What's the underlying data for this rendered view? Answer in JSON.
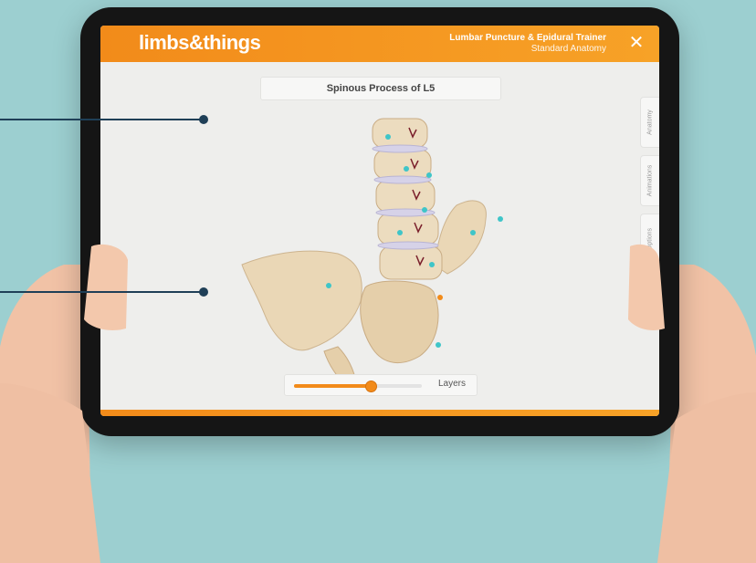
{
  "app": {
    "logo": "limbs&things",
    "title": "Lumbar Puncture & Epidural Trainer",
    "subtitle": "Standard Anatomy",
    "close_icon": "close-icon"
  },
  "viewer": {
    "structure_label": "Spinous Process of L5",
    "side_tabs": [
      "Anatomy",
      "Animations",
      "Options"
    ]
  },
  "layers": {
    "label": "Layers",
    "slider_fraction": 0.6
  },
  "colors": {
    "brand_orange": "#f28b1a",
    "background": "#9ccfd0",
    "annotation": "#1f3f57",
    "marker": "#3fc5c8"
  }
}
